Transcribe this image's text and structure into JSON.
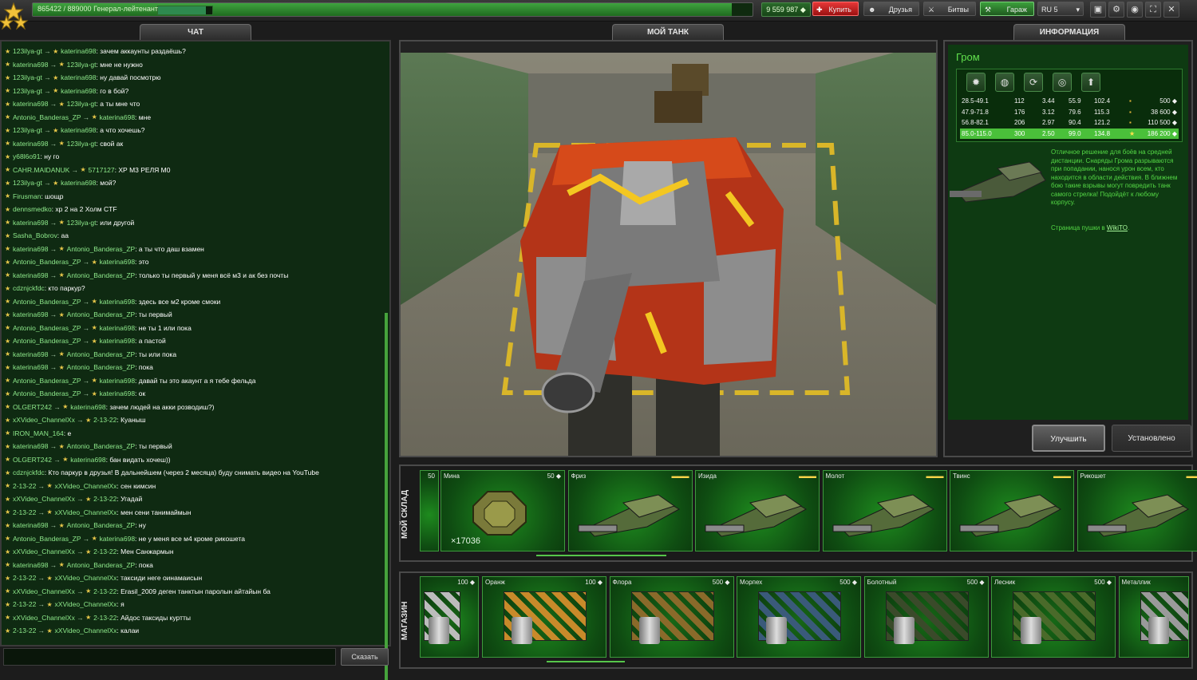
{
  "topbar": {
    "progress_text": "865422 / 889000  Генерал-лейтенант",
    "progress_fraction": 0.973,
    "crystals": "9 559 987",
    "buy_label": "Купить",
    "friends_label": "Друзья",
    "battles_label": "Битвы",
    "garage_label": "Гараж",
    "server_label": "RU 5"
  },
  "tabs": {
    "chat": "ЧАТ",
    "my_tank": "МОЙ ТАНК",
    "info": "ИНФОРМАЦИЯ"
  },
  "chat": {
    "messages": [
      {
        "from": "123ilya-gt",
        "to": "katerina698",
        "text": "зачем аккаунты раздаёшь?"
      },
      {
        "from": "katerina698",
        "to": "123ilya-gt",
        "text": "мне не нужно"
      },
      {
        "from": "123ilya-gt",
        "to": "katerina698",
        "text": "ну давай посмотрю"
      },
      {
        "from": "123ilya-gt",
        "to": "katerina698",
        "text": "го в бой?"
      },
      {
        "from": "katerina698",
        "to": "123ilya-gt",
        "text": "а ты мне что"
      },
      {
        "from": "Antonio_Banderas_ZP",
        "to": "katerina698",
        "text": "мне"
      },
      {
        "from": "123ilya-gt",
        "to": "katerina698",
        "text": "а что хочешь?"
      },
      {
        "from": "katerina698",
        "to": "123ilya-gt",
        "text": "свой ак"
      },
      {
        "from": "y68l6o91",
        "to": "",
        "text": "ну го"
      },
      {
        "from": "CAHR.MAIDANUK",
        "to": "5717127",
        "text": "ХР М3 РЕЛЯ М0"
      },
      {
        "from": "123ilya-gt",
        "to": "katerina698",
        "text": "мой?"
      },
      {
        "from": "Firusman",
        "to": "",
        "text": "шощр"
      },
      {
        "from": "dennsmedko",
        "to": "",
        "text": "хр 2 на 2 Холм CTF"
      },
      {
        "from": "katerina698",
        "to": "123ilya-gt",
        "text": "или другой"
      },
      {
        "from": "Sasha_Bobrov",
        "to": "",
        "text": "аа"
      },
      {
        "from": "katerina698",
        "to": "Antonio_Banderas_ZP",
        "text": "а ты что даш взамен"
      },
      {
        "from": "Antonio_Banderas_ZP",
        "to": "katerina698",
        "text": "это"
      },
      {
        "from": "katerina698",
        "to": "Antonio_Banderas_ZP",
        "text": "только ты первый у меня всё м3 и ак без почты"
      },
      {
        "from": "cdznjckfdc",
        "to": "",
        "text": "кто паркур?"
      },
      {
        "from": "Antonio_Banderas_ZP",
        "to": "katerina698",
        "text": "здесь все м2 кроме смоки"
      },
      {
        "from": "katerina698",
        "to": "Antonio_Banderas_ZP",
        "text": "ты первый"
      },
      {
        "from": "Antonio_Banderas_ZP",
        "to": "katerina698",
        "text": "не ты 1 или пока"
      },
      {
        "from": "Antonio_Banderas_ZP",
        "to": "katerina698",
        "text": "а пастой"
      },
      {
        "from": "katerina698",
        "to": "Antonio_Banderas_ZP",
        "text": "ты или пока"
      },
      {
        "from": "katerina698",
        "to": "Antonio_Banderas_ZP",
        "text": "пока"
      },
      {
        "from": "Antonio_Banderas_ZP",
        "to": "katerina698",
        "text": "давай ты это акаунт а я тебе фельда"
      },
      {
        "from": "Antonio_Banderas_ZP",
        "to": "katerina698",
        "text": "ок"
      },
      {
        "from": "OLGERT242",
        "to": "katerina698",
        "text": "зачем людей на акки розводиш?)"
      },
      {
        "from": "xXVideo_ChannelXx",
        "to": "2-13-22",
        "text": "Куаныш"
      },
      {
        "from": "IRON_MAN_164",
        "to": "",
        "text": "е"
      },
      {
        "from": "katerina698",
        "to": "Antonio_Banderas_ZP",
        "text": "ты первый"
      },
      {
        "from": "OLGERT242",
        "to": "katerina698",
        "text": "бан видать хочеш))"
      },
      {
        "from": "cdznjckfdc",
        "to": "",
        "text": "Кто паркур в друзья! В дальнейшем (через 2 месяца) буду снимать видео на YouTube"
      },
      {
        "from": "2-13-22",
        "to": "xXVideo_ChannelXx",
        "text": "сен кимсин"
      },
      {
        "from": "xXVideo_ChannelXx",
        "to": "2-13-22",
        "text": "Угадай"
      },
      {
        "from": "2-13-22",
        "to": "xXVideo_ChannelXx",
        "text": "мен сени танимаймын"
      },
      {
        "from": "katerina698",
        "to": "Antonio_Banderas_ZP",
        "text": "ну"
      },
      {
        "from": "Antonio_Banderas_ZP",
        "to": "katerina698",
        "text": "не у меня все м4 кроме рикошета"
      },
      {
        "from": "xXVideo_ChannelXx",
        "to": "2-13-22",
        "text": "Мен Санжармын"
      },
      {
        "from": "katerina698",
        "to": "Antonio_Banderas_ZP",
        "text": "пока"
      },
      {
        "from": "2-13-22",
        "to": "xXVideo_ChannelXx",
        "text": "таксиди неге оинамаисын"
      },
      {
        "from": "xXVideo_ChannelXx",
        "to": "2-13-22",
        "text": "Erasil_2009 деген танктын паролын айтайын ба"
      },
      {
        "from": "2-13-22",
        "to": "xXVideo_ChannelXx",
        "text": "я"
      },
      {
        "from": "xXVideo_ChannelXx",
        "to": "2-13-22",
        "text": "Айдос таксиды куртты"
      },
      {
        "from": "2-13-22",
        "to": "xXVideo_ChannelXx",
        "text": "калаи"
      }
    ],
    "say_label": "Сказать"
  },
  "info": {
    "title": "Гром",
    "stat_icons": [
      "damage-icon",
      "impact-icon",
      "reload-icon",
      "range-icon",
      "upgrade-icon"
    ],
    "stat_rows": [
      {
        "c": [
          "28.5-49.1",
          "112",
          "3.44",
          "55.9",
          "102.4"
        ],
        "price": "500",
        "active": false
      },
      {
        "c": [
          "47.9-71.8",
          "176",
          "3.12",
          "79.6",
          "115.3"
        ],
        "price": "38 600",
        "active": false
      },
      {
        "c": [
          "56.8-82.1",
          "206",
          "2.97",
          "90.4",
          "121.2"
        ],
        "price": "110 500",
        "active": false
      },
      {
        "c": [
          "85.0-115.0",
          "300",
          "2.50",
          "99.0",
          "134.8"
        ],
        "price": "186 200",
        "active": true
      }
    ],
    "description": "Отличное решение для боёв на средней дистанции. Снаряды Грома разрываются при попадании, нанося урон всем, кто находится в области действия. В ближнем бою такие взрывы могут повредить танк самого стрелка! Подойдёт к любому корпусу.",
    "wiki_prefix": "Страница пушки в ",
    "wiki_link": "WikiTO",
    "wiki_suffix": ".",
    "improve_label": "Улучшить",
    "installed_label": "Установлено"
  },
  "warehouse": {
    "label": "МОЙ СКЛАД",
    "partial_price": "50",
    "items": [
      {
        "name": "Мина",
        "price": "50",
        "qty": "×17036",
        "kind": "mine"
      },
      {
        "name": "Фриз",
        "kind": "turret",
        "lv": "▬▬▬"
      },
      {
        "name": "Изида",
        "kind": "turret",
        "lv": "▬▬▬"
      },
      {
        "name": "Молот",
        "kind": "turret",
        "lv": "▬▬▬"
      },
      {
        "name": "Твинс",
        "kind": "turret",
        "lv": "▬▬▬"
      },
      {
        "name": "Рикошет",
        "kind": "turret",
        "lv": "▬▬"
      }
    ]
  },
  "shop": {
    "label": "МАГАЗИН",
    "items": [
      {
        "name": "",
        "price": "100",
        "color": "#bcbcbc"
      },
      {
        "name": "Оранж",
        "price": "100",
        "color": "#c88a2a"
      },
      {
        "name": "Флора",
        "price": "500",
        "color": "#8a6a2a"
      },
      {
        "name": "Морпех",
        "price": "500",
        "color": "#3a5a7a"
      },
      {
        "name": "Болотный",
        "price": "500",
        "color": "#3a4a2a"
      },
      {
        "name": "Лесник",
        "price": "500",
        "color": "#4a6a2a"
      },
      {
        "name": "Металлик",
        "price": "",
        "color": "#9a9a9a"
      }
    ]
  }
}
